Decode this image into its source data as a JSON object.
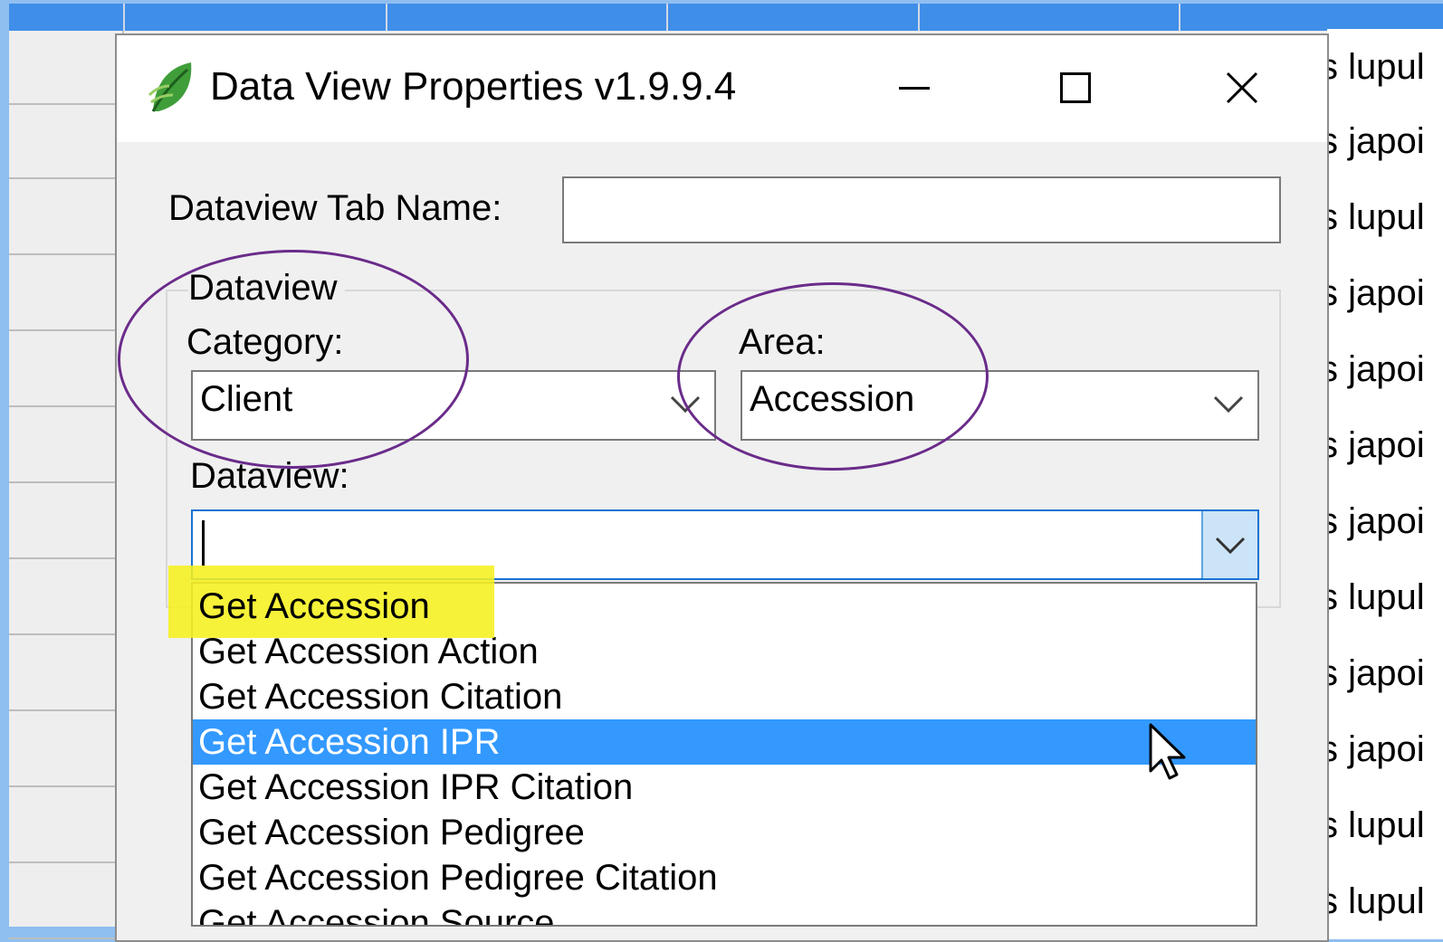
{
  "background": {
    "cells": [
      "s lupul",
      "s japoi",
      "s lupul",
      "s japoi",
      "s japoi",
      "s japoi",
      "s japoi",
      "s lupul",
      "s japoi",
      "s japoi",
      "s lupul",
      "s lupul"
    ]
  },
  "dialog": {
    "title": "Data View Properties v1.9.9.4",
    "icon": "leaf-app-icon",
    "controls": [
      "minimize-icon",
      "maximize-icon",
      "close-icon"
    ]
  },
  "form": {
    "tab_name_label": "Dataview Tab Name:",
    "tab_name_value": "",
    "group_label": "Dataview",
    "category_label": "Category:",
    "category_value": "Client",
    "area_label": "Area:",
    "area_value": "Accession",
    "dataview_label": "Dataview:",
    "dataview_value": ""
  },
  "dropdown": {
    "items": [
      "Get Accession",
      "Get Accession Action",
      "Get Accession Citation",
      "Get Accession IPR",
      "Get Accession IPR Citation",
      "Get Accession Pedigree",
      "Get Accession Pedigree Citation",
      "Get Accession Source"
    ],
    "selected": "Get Accession IPR",
    "highlighted": "Get Accession"
  },
  "colors": {
    "selection": "#3399ff",
    "highlight": "#f5f01e",
    "annotation": "#6a2b8a",
    "desktop": "#8fbff0"
  }
}
